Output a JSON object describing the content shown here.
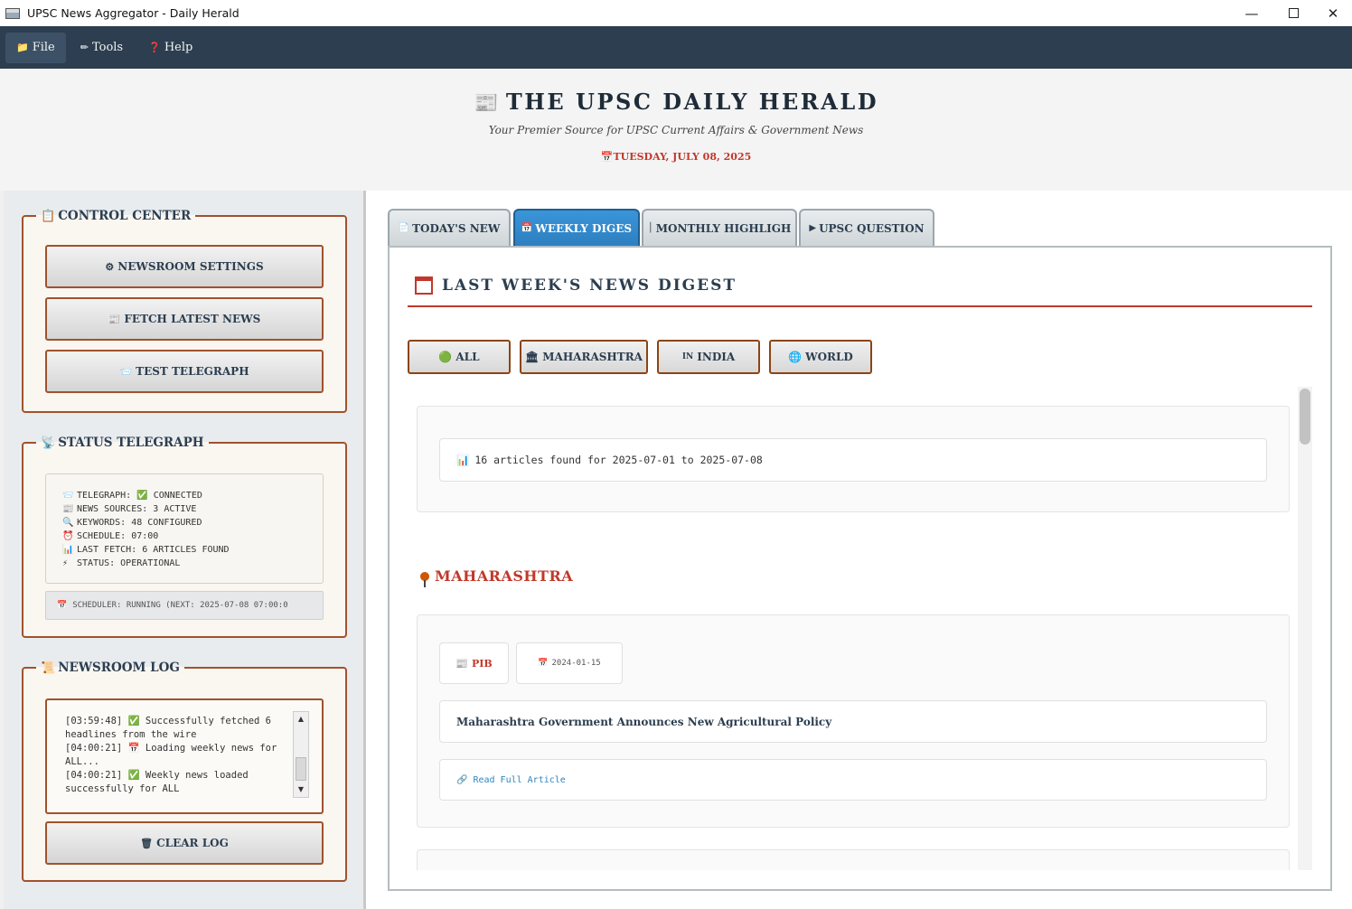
{
  "window": {
    "title": "UPSC News Aggregator - Daily Herald",
    "controls": {
      "minimize": "—",
      "maximize": "",
      "close": "✕"
    }
  },
  "menubar": {
    "items": [
      {
        "icon": "📁",
        "label": "File"
      },
      {
        "icon": "✏",
        "label": "Tools"
      },
      {
        "icon": "❓",
        "label": "Help"
      }
    ]
  },
  "masthead": {
    "icon": "📰",
    "title": "THE UPSC DAILY HERALD",
    "tagline": "Your Premier Source for UPSC Current Affairs & Government News",
    "date_icon": "📅",
    "date": "TUESDAY, JULY 08, 2025"
  },
  "control_center": {
    "icon": "📋",
    "title": "CONTROL CENTER",
    "buttons": [
      {
        "icon": "⚙",
        "label": "NEWSROOM SETTINGS"
      },
      {
        "icon": "📰",
        "label": "FETCH LATEST NEWS"
      },
      {
        "icon": "📨",
        "label": "TEST TELEGRAPH"
      }
    ]
  },
  "status_telegraph": {
    "icon": "📡",
    "title": "STATUS TELEGRAPH",
    "lines": [
      {
        "icon": "📨",
        "text": "TELEGRAPH: ✅ CONNECTED"
      },
      {
        "icon": "📰",
        "text": "NEWS SOURCES: 3 ACTIVE"
      },
      {
        "icon": "🔍",
        "text": "KEYWORDS: 48 CONFIGURED"
      },
      {
        "icon": "⏰",
        "text": "SCHEDULE: 07:00"
      },
      {
        "icon": "📊",
        "text": "LAST FETCH: 6 ARTICLES FOUND"
      },
      {
        "icon": "⚡",
        "text": "STATUS: OPERATIONAL"
      }
    ],
    "scheduler_icon": "📅",
    "scheduler": "SCHEDULER: RUNNING (NEXT: 2025-07-08 07:00:0"
  },
  "newsroom_log": {
    "icon": "📜",
    "title": "NEWSROOM LOG",
    "entries": [
      "[03:59:48] ✅ Successfully fetched 6 headlines from the wire",
      "[04:00:21] 📅 Loading weekly news for ALL...",
      "[04:00:21] ✅ Weekly news loaded successfully for ALL"
    ],
    "clear_icon": "🗑",
    "clear_label": "CLEAR LOG"
  },
  "tabs": [
    {
      "icon": "📄",
      "label": "TODAY'S NEW"
    },
    {
      "icon": "📅",
      "label": "WEEKLY DIGES"
    },
    {
      "icon": "│",
      "label": "MONTHLY HIGHLIGH"
    },
    {
      "icon": "▶",
      "label": "UPSC QUESTION"
    }
  ],
  "digest": {
    "title": "LAST WEEK'S NEWS DIGEST",
    "filters": [
      {
        "icon": "🟢",
        "label": "ALL"
      },
      {
        "icon": "🏛",
        "label": "MAHARASHTRA"
      },
      {
        "icon": "IN",
        "label": "INDIA"
      },
      {
        "icon": "🌐",
        "label": "WORLD"
      }
    ],
    "summary_icon": "📊",
    "summary": "16 articles found for 2025-07-01 to 2025-07-08",
    "region": "MAHARASHTRA",
    "article": {
      "source_icon": "📰",
      "source": "PIB",
      "date_icon": "📅",
      "date": "2024-01-15",
      "headline": "Maharashtra Government Announces New Agricultural Policy",
      "link_icon": "🔗",
      "link": "Read Full Article"
    }
  },
  "colors": {
    "menubar": "#2c3e50",
    "accent_red": "#c0392b",
    "border_brown": "#a0522d",
    "active_tab": "#2d7fc0"
  }
}
